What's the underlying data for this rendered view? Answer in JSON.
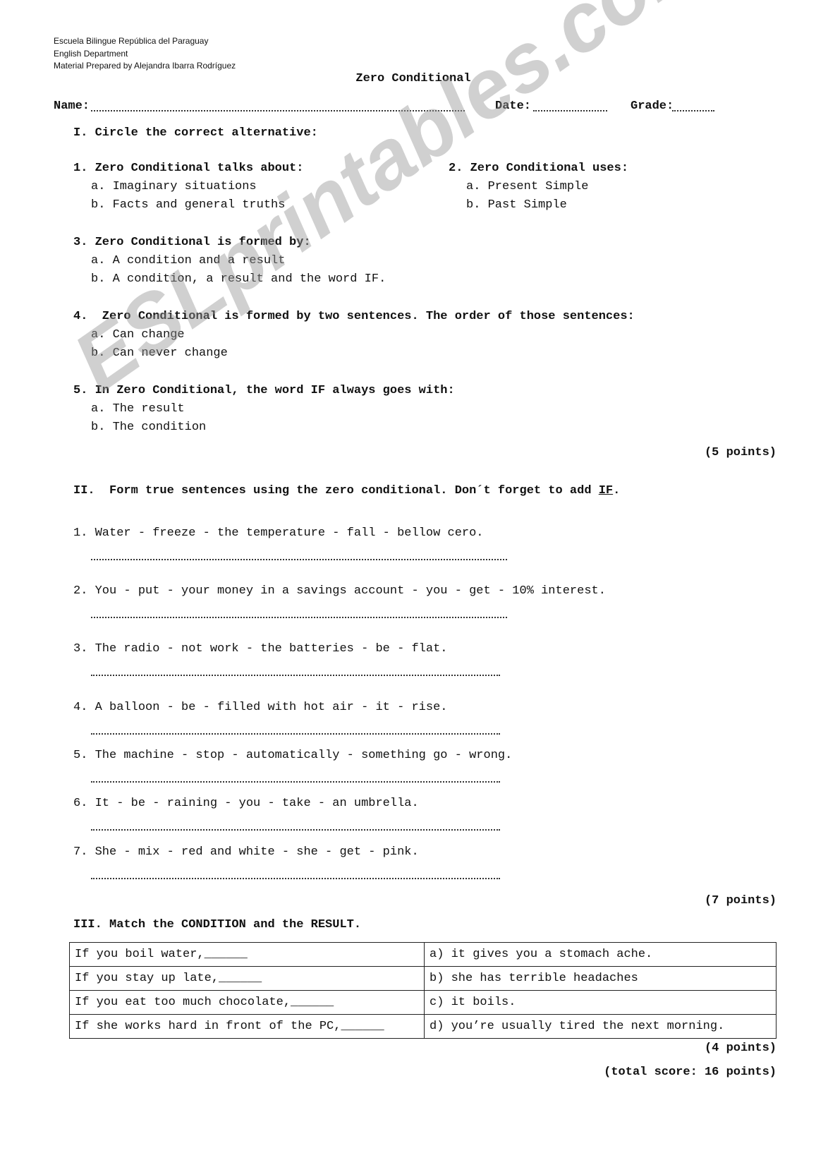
{
  "header": {
    "school": "Escuela Bilingue República del Paraguay",
    "department": "English Department",
    "author": "Material Prepared by Alejandra Ibarra Rodríguez"
  },
  "title": "Zero Conditional",
  "fields": {
    "name": "Name:",
    "date": "Date:",
    "grade": "Grade:"
  },
  "watermark": "ESLprintables.com",
  "section1": {
    "heading": "I. Circle the correct alternative:",
    "questions": [
      {
        "q": "1. Zero Conditional talks about:",
        "a": "a. Imaginary situations",
        "b": "b. Facts and general truths"
      },
      {
        "q": "2. Zero Conditional uses:",
        "a": "a. Present Simple",
        "b": "b. Past Simple"
      },
      {
        "q": "3. Zero Conditional is formed by:",
        "a": "a. A condition and a result",
        "b": "b. A condition, a result and the word IF."
      },
      {
        "q": "4.  Zero Conditional is formed by two sentences. The order of those sentences:",
        "a": "a. Can change",
        "b": "b. Can never change"
      },
      {
        "q": "5. In Zero Conditional, the word IF always goes with:",
        "a": "a. The result",
        "b": "b. The condition"
      }
    ],
    "points": "(5 points)"
  },
  "section2": {
    "heading": "II.  Form true sentences using the zero conditional. Don´t forget to add ",
    "heading_em": "IF",
    "heading_end": ".",
    "items": [
      "1. Water - freeze - the temperature - fall - bellow cero.",
      "2. You - put - your money in a savings account - you - get - 10% interest.",
      "3. The radio - not work - the batteries - be - flat.",
      "4. A balloon - be - filled with hot air - it - rise.",
      "5. The machine - stop - automatically - something go - wrong.",
      "6. It - be - raining - you - take - an umbrella.",
      "7. She - mix - red and white - she - get - pink."
    ],
    "points": "(7 points)"
  },
  "section3": {
    "heading": "III. Match the CONDITION and the RESULT.",
    "rows": [
      {
        "condition": "If you boil water,______",
        "result": "a) it gives you a stomach ache."
      },
      {
        "condition": "If you stay up late,______",
        "result": "b) she has terrible headaches"
      },
      {
        "condition": "If you eat too much chocolate,______",
        "result": "c) it boils."
      },
      {
        "condition": "If she works hard in front of the PC,______",
        "result": "d) you’re usually tired the next morning."
      }
    ],
    "points": "(4 points)"
  },
  "total": "(total score: 16 points)"
}
